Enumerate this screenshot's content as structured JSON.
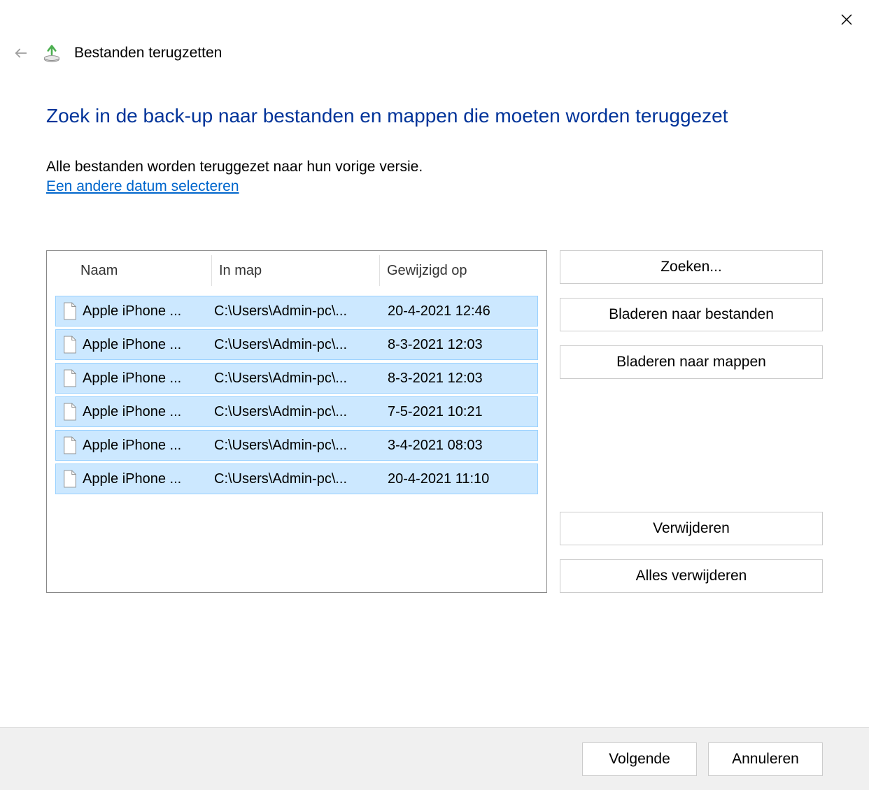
{
  "window": {
    "title": "Bestanden terugzetten"
  },
  "content": {
    "heading": "Zoek in de back-up naar bestanden en mappen die moeten worden teruggezet",
    "subtext": "Alle bestanden worden teruggezet naar hun vorige versie.",
    "link": "Een andere datum selecteren"
  },
  "list": {
    "headers": {
      "name": "Naam",
      "folder": "In map",
      "date": "Gewijzigd op"
    },
    "rows": [
      {
        "name": "Apple iPhone ...",
        "folder": "C:\\Users\\Admin-pc\\...",
        "date": "20-4-2021 12:46"
      },
      {
        "name": "Apple iPhone ...",
        "folder": "C:\\Users\\Admin-pc\\...",
        "date": "8-3-2021 12:03"
      },
      {
        "name": "Apple iPhone ...",
        "folder": "C:\\Users\\Admin-pc\\...",
        "date": "8-3-2021 12:03"
      },
      {
        "name": "Apple iPhone ...",
        "folder": "C:\\Users\\Admin-pc\\...",
        "date": "7-5-2021 10:21"
      },
      {
        "name": "Apple iPhone ...",
        "folder": "C:\\Users\\Admin-pc\\...",
        "date": "3-4-2021 08:03"
      },
      {
        "name": "Apple iPhone ...",
        "folder": "C:\\Users\\Admin-pc\\...",
        "date": "20-4-2021 11:10"
      }
    ]
  },
  "buttons": {
    "search": "Zoeken...",
    "browse_files": "Bladeren naar bestanden",
    "browse_folders": "Bladeren naar mappen",
    "remove": "Verwijderen",
    "remove_all": "Alles verwijderen",
    "next": "Volgende",
    "cancel": "Annuleren"
  }
}
